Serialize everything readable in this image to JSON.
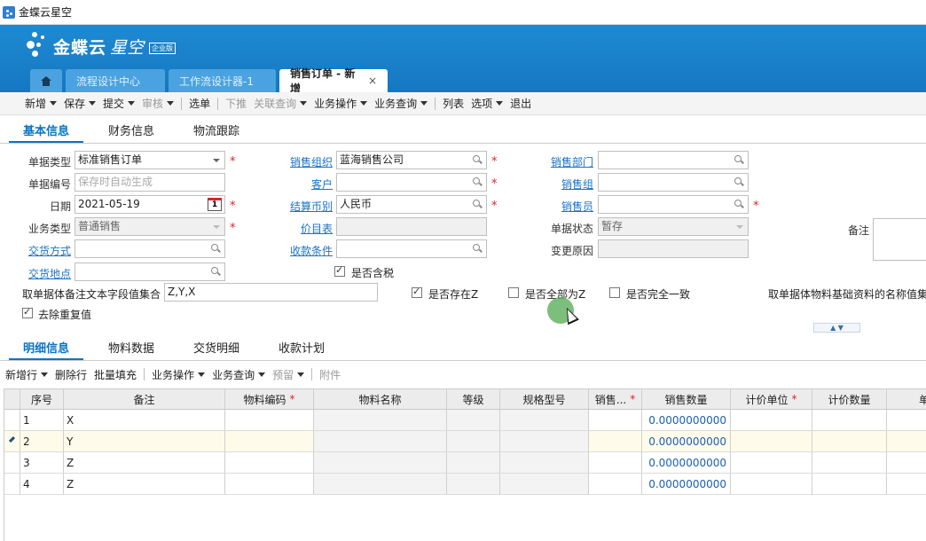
{
  "window": {
    "title": "金蝶云星空"
  },
  "brand": {
    "name": "金蝶云",
    "product": "星空",
    "edition": "企业版"
  },
  "tabs": [
    {
      "label": "流程设计中心"
    },
    {
      "label": "工作流设计器-1"
    },
    {
      "label": "销售订单 - 新增",
      "close": "×"
    }
  ],
  "toolbar": {
    "new": "新增",
    "save": "保存",
    "submit": "提交",
    "audit": "审核",
    "select": "选单",
    "push": "下推",
    "related_query": "关联查询",
    "biz_operation": "业务操作",
    "biz_query": "业务查询",
    "list": "列表",
    "options": "选项",
    "exit": "退出"
  },
  "header_tabs": [
    "基本信息",
    "财务信息",
    "物流跟踪"
  ],
  "form": {
    "bill_type_label": "单据类型",
    "bill_type_value": "标准销售订单",
    "bill_no_label": "单据编号",
    "bill_no_placeholder": "保存时自动生成",
    "date_label": "日期",
    "date_value": "2021-05-19",
    "cal_day": "1",
    "biz_type_label": "业务类型",
    "biz_type_value": "普通销售",
    "delivery_method_label": "交货方式",
    "delivery_place_label": "交货地点",
    "sale_org_label": "销售组织",
    "sale_org_value": "蓝海销售公司",
    "customer_label": "客户",
    "currency_label": "结算币别",
    "currency_value": "人民币",
    "price_list_label": "价目表",
    "receipt_cond_label": "收款条件",
    "tax_incl_label": "是否含税",
    "sale_dept_label": "销售部门",
    "sale_group_label": "销售组",
    "salesman_label": "销售员",
    "bill_status_label": "单据状态",
    "bill_status_value": "暂存",
    "change_reason_label": "变更原因",
    "remark_label": "备注",
    "remark_concat_label": "取单据体备注文本字段值集合",
    "remark_concat_value": "Z,Y,X",
    "has_z_label": "是否存在Z",
    "all_z_label": "是否全部为Z",
    "all_same_label": "是否完全一致",
    "material_names_label": "取单据体物料基础资料的名称值集",
    "dedupe_label": "去除重复值",
    "collapse_label": "▲ ▼"
  },
  "detail_tabs": [
    "明细信息",
    "物料数据",
    "交货明细",
    "收款计划"
  ],
  "detail_toolbar": {
    "add_row": "新增行",
    "delete_row": "删除行",
    "batch_fill": "批量填充",
    "biz_operation": "业务操作",
    "biz_query": "业务查询",
    "reserve": "预留",
    "attachment": "附件"
  },
  "grid": {
    "columns": [
      {
        "label": "序号",
        "required": false
      },
      {
        "label": "备注",
        "required": false
      },
      {
        "label": "物料编码",
        "required": true
      },
      {
        "label": "物料名称",
        "required": false
      },
      {
        "label": "等级",
        "required": false
      },
      {
        "label": "规格型号",
        "required": false
      },
      {
        "label": "销售...",
        "required": true
      },
      {
        "label": "销售数量",
        "required": false
      },
      {
        "label": "计价单位",
        "required": true
      },
      {
        "label": "计价数量",
        "required": false
      },
      {
        "label": "单",
        "required": false
      }
    ],
    "required_mark": "*",
    "rows": [
      {
        "seq": "1",
        "remark": "X",
        "qty": "0.0000000000"
      },
      {
        "seq": "2",
        "remark": "Y",
        "qty": "0.0000000000"
      },
      {
        "seq": "3",
        "remark": "Z",
        "qty": "0.0000000000"
      },
      {
        "seq": "4",
        "remark": "Z",
        "qty": "0.0000000000"
      }
    ]
  },
  "colors": {
    "banner": "#1577c2",
    "link": "#1a73c8",
    "required": "#e02020",
    "active_tab": "#0b74c4"
  }
}
